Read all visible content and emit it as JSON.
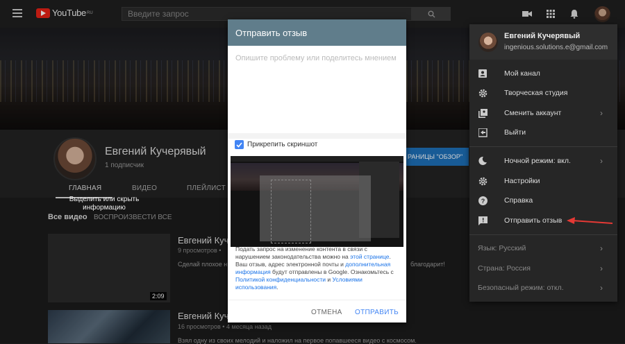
{
  "topbar": {
    "logo_text": "YouTube",
    "logo_region": "RU",
    "search_placeholder": "Введите запрос"
  },
  "channel": {
    "name": "Евгений Кучерявый",
    "subscribers": "1 подписчик",
    "overview_button": "РАНИЦЫ \"ОБЗОР\"",
    "tabs": [
      "ГЛАВНАЯ",
      "ВИДЕО",
      "ПЛЕЙЛИСТ"
    ]
  },
  "videos_section": {
    "title": "Все видео",
    "play_all": "ВОСПРОИЗВЕСТИ ВСЕ",
    "items": [
      {
        "title": "Евгений Куч",
        "meta": "9 просмотров •",
        "desc": "Сделай плохое н",
        "desc_tail": "благодарит!",
        "duration": "2:09"
      },
      {
        "title": "Евгений Куч",
        "meta": "16 просмотров • 4 месяца назад",
        "desc": "Взял одну из своих мелодий и наложил на первое попавшееся видео с космосом."
      }
    ]
  },
  "feedback_dialog": {
    "title": "Отправить отзыв",
    "placeholder": "Опишите проблему или поделитесь мнением",
    "attach_label": "Прикрепить скриншот",
    "screenshot_hint": "Выделить или скрыть информацию",
    "body_1": "Подать запрос на изменение контента в связи с нарушением законодательства можно на ",
    "link_this_page": "этой странице",
    "body_2": ". Ваш отзыв, адрес электронной почты и ",
    "link_additional": "дополнительная информация",
    "body_3": " будут отправлены в Google. Ознакомьтесь с ",
    "link_privacy": "Политикой конфиденциальности",
    "body_4": " и ",
    "link_terms": "Условиями использования",
    "body_5": ".",
    "cancel": "ОТМЕНА",
    "send": "ОТПРАВИТЬ"
  },
  "account_menu": {
    "name": "Евгений Кучерявый",
    "email": "ingenious.solutions.e@gmail.com",
    "items": [
      {
        "label": "Мой канал",
        "icon": "account-box-icon"
      },
      {
        "label": "Творческая студия",
        "icon": "gear-icon"
      },
      {
        "label": "Сменить аккаунт",
        "icon": "switch-account-icon"
      },
      {
        "label": "Выйти",
        "icon": "logout-icon"
      },
      {
        "label": "Ночной режим: вкл.",
        "icon": "moon-icon"
      },
      {
        "label": "Настройки",
        "icon": "gear-icon"
      },
      {
        "label": "Справка",
        "icon": "help-icon"
      },
      {
        "label": "Отправить отзыв",
        "icon": "feedback-icon"
      },
      {
        "label": "Язык: Русский"
      },
      {
        "label": "Страна: Россия"
      },
      {
        "label": "Безопасный режим: откл."
      }
    ]
  },
  "colors": {
    "dialog_header": "#607d8b",
    "link": "#1a73e8",
    "send_button": "#4285f4",
    "annotation_arrow": "#e53935",
    "youtube_red": "#e62117"
  }
}
